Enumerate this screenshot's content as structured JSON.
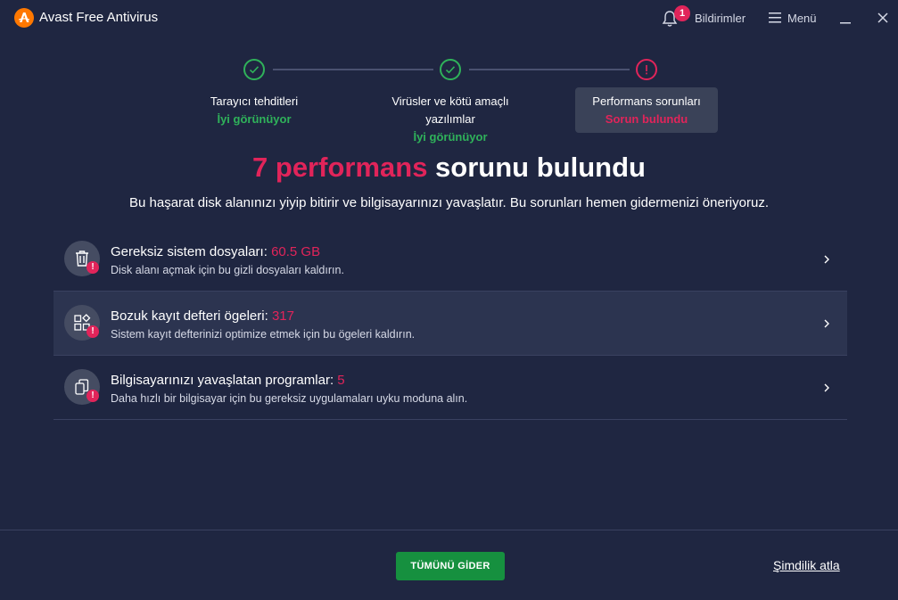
{
  "app": {
    "title": "Avast Free Antivirus"
  },
  "header": {
    "notifications_label": "Bildirimler",
    "notifications_count": "1",
    "menu_label": "Menü"
  },
  "steps": [
    {
      "line1": "Tarayıcı tehditleri",
      "line2": "",
      "status": "İyi görünüyor",
      "state": "ok"
    },
    {
      "line1": "Virüsler ve kötü amaçlı",
      "line2": "yazılımlar",
      "status": "İyi görünüyor",
      "state": "ok"
    },
    {
      "line1": "Performans sorunları",
      "line2": "",
      "status": "Sorun bulundu",
      "state": "problem"
    }
  ],
  "headline": {
    "count_part": "7 performans",
    "rest": " sorunu bulundu"
  },
  "subtitle": "Bu haşarat disk alanınızı yiyip bitirir ve bilgisayarınızı yavaşlatır. Bu sorunları hemen gidermenizi öneriyoruz.",
  "issues": [
    {
      "title": "Gereksiz sistem dosyaları: ",
      "value": "60.5 GB",
      "desc": "Disk alanı açmak için bu gizli dosyaları kaldırın.",
      "icon": "trash-icon"
    },
    {
      "title": "Bozuk kayıt defteri ögeleri: ",
      "value": "317",
      "desc": "Sistem kayıt defterinizi optimize etmek için bu ögeleri kaldırın.",
      "icon": "registry-icon"
    },
    {
      "title": "Bilgisayarınızı yavaşlatan programlar: ",
      "value": "5",
      "desc": "Daha hızlı bir bilgisayar için bu gereksiz uygulamaları uyku moduna alın.",
      "icon": "programs-icon"
    }
  ],
  "footer": {
    "fix_all_label": "TÜMÜNÜ GİDER",
    "skip_label": "Şimdilik atla"
  },
  "colors": {
    "background": "#1f2641",
    "accent_red": "#e1245a",
    "accent_green": "#2fb25a",
    "button_green": "#16903f",
    "brand_orange": "#ff7800"
  }
}
